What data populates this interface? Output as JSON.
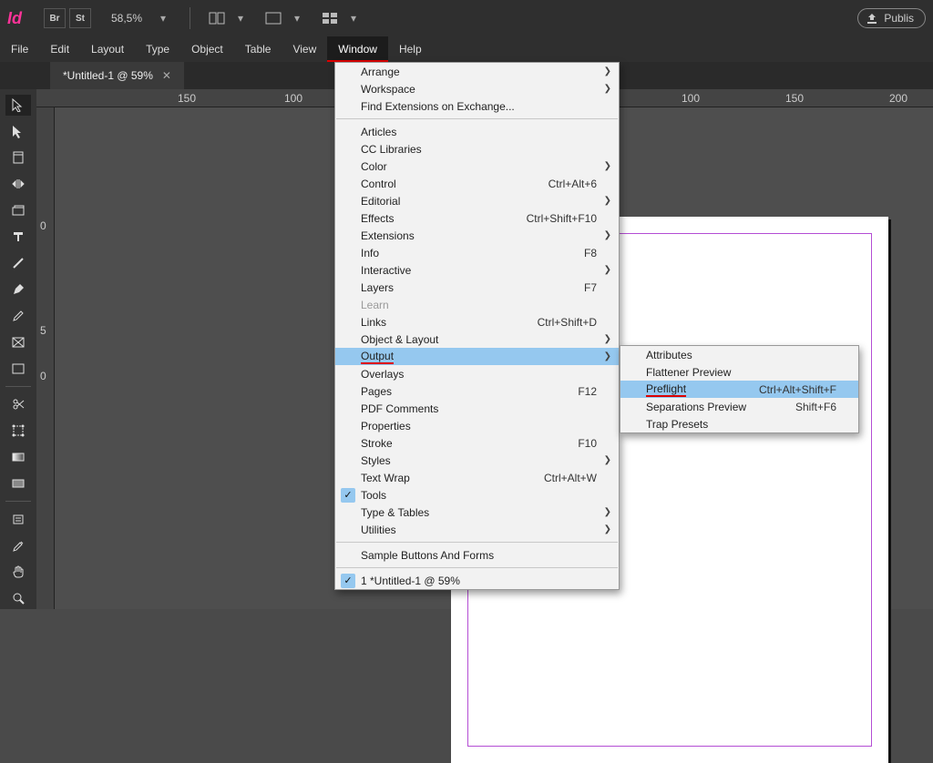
{
  "titlebar": {
    "app_abbrev": "Id",
    "bridge_label": "Br",
    "stock_label": "St",
    "zoom_text": "58,5%",
    "publish_label": "Publis"
  },
  "menubar": {
    "items": [
      "File",
      "Edit",
      "Layout",
      "Type",
      "Object",
      "Table",
      "View",
      "Window",
      "Help"
    ],
    "active_index": 7
  },
  "tabs": {
    "items": [
      {
        "label": "*Untitled-1 @ 59%"
      }
    ]
  },
  "ruler_h": {
    "marks": [
      {
        "value": "150",
        "pos": 165
      },
      {
        "value": "100",
        "pos": 282
      },
      {
        "value": "100",
        "pos": 718
      },
      {
        "value": "150",
        "pos": 832
      },
      {
        "value": "200",
        "pos": 946
      }
    ]
  },
  "ruler_v": {
    "marks": [
      {
        "value": "0",
        "pos": 130
      },
      {
        "value": "5",
        "pos": 245
      },
      {
        "value": "0",
        "pos": 295
      }
    ]
  },
  "window_menu": {
    "sections": [
      [
        {
          "label": "Arrange",
          "arrow": true
        },
        {
          "label": "Workspace",
          "arrow": true
        },
        {
          "label": "Find Extensions on Exchange..."
        }
      ],
      [
        {
          "label": "Articles"
        },
        {
          "label": "CC Libraries"
        },
        {
          "label": "Color",
          "arrow": true
        },
        {
          "label": "Control",
          "shortcut": "Ctrl+Alt+6"
        },
        {
          "label": "Editorial",
          "arrow": true
        },
        {
          "label": "Effects",
          "shortcut": "Ctrl+Shift+F10"
        },
        {
          "label": "Extensions",
          "arrow": true
        },
        {
          "label": "Info",
          "shortcut": "F8"
        },
        {
          "label": "Interactive",
          "arrow": true
        },
        {
          "label": "Layers",
          "shortcut": "F7"
        },
        {
          "label": "Learn",
          "disabled": true
        },
        {
          "label": "Links",
          "shortcut": "Ctrl+Shift+D"
        },
        {
          "label": "Object & Layout",
          "arrow": true
        },
        {
          "label": "Output",
          "arrow": true,
          "highlight": true,
          "underline": true
        },
        {
          "label": "Overlays"
        },
        {
          "label": "Pages",
          "shortcut": "F12"
        },
        {
          "label": "PDF Comments"
        },
        {
          "label": "Properties"
        },
        {
          "label": "Stroke",
          "shortcut": "F10"
        },
        {
          "label": "Styles",
          "arrow": true
        },
        {
          "label": "Text Wrap",
          "shortcut": "Ctrl+Alt+W"
        },
        {
          "label": "Tools",
          "checked": true
        },
        {
          "label": "Type & Tables",
          "arrow": true
        },
        {
          "label": "Utilities",
          "arrow": true
        }
      ],
      [
        {
          "label": "Sample Buttons And Forms"
        }
      ],
      [
        {
          "label": "1 *Untitled-1 @ 59%",
          "checked": true
        }
      ]
    ]
  },
  "output_submenu": {
    "items": [
      {
        "label": "Attributes"
      },
      {
        "label": "Flattener Preview"
      },
      {
        "label": "Preflight",
        "shortcut": "Ctrl+Alt+Shift+F",
        "highlight": true,
        "underline": true
      },
      {
        "label": "Separations Preview",
        "shortcut": "Shift+F6"
      },
      {
        "label": "Trap Presets"
      }
    ]
  }
}
